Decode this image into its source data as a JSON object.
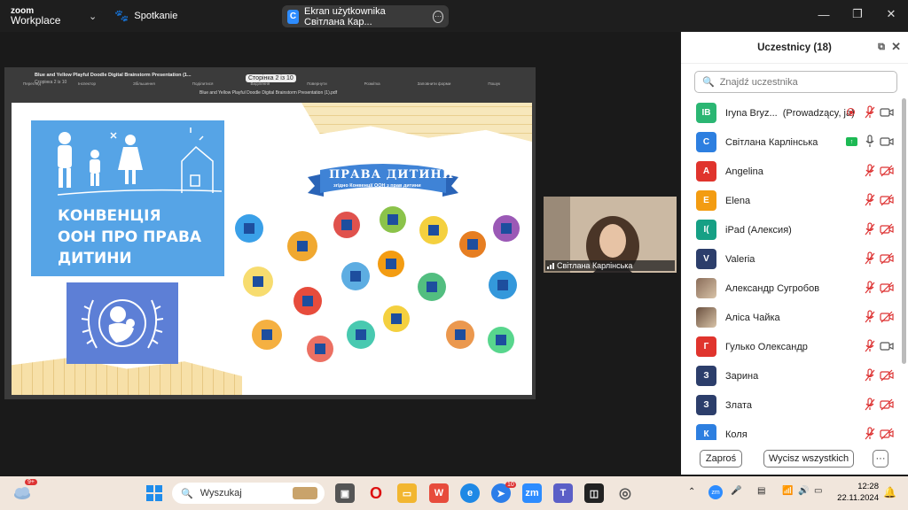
{
  "app": {
    "logo_line1": "zoom",
    "logo_line2": "Workplace",
    "meeting_label": "Spotkanie",
    "share_label": "Ekran użytkownika Світлана Кар..."
  },
  "viewer": {
    "doc_title": "Blue and Yellow Playful Doodle Digital Brainstorm Presentation (1...",
    "page_info": "Сторінка 2 із 10",
    "page_pill": "Сторінка 2 із 10",
    "subtitle": "Blue and Yellow Playful Doodle Digital Brainstorm Presentation (1).pdf",
    "tools": [
      "Перегляд",
      "Інспектор",
      "Збільшення",
      "Поділитися",
      "Виділення",
      "Повернути",
      "Розмітка",
      "Заповнити форми",
      "Пошук"
    ]
  },
  "slide": {
    "convention_text": [
      "КОНВЕНЦІЯ",
      "ООН ПРО ПРАВА",
      "ДИТИНИ"
    ],
    "banner_title": "ПРАВА ДИТИНИ",
    "banner_sub": "згідно Конвенції ООН з прав дитини"
  },
  "video": {
    "name": "Світлана Карлінська"
  },
  "panel": {
    "title": "Uczestnicy (18)",
    "search_placeholder": "Znajdź uczestnika",
    "participants": [
      {
        "initials": "IB",
        "name": "Iryna Bryz...",
        "role": "(Prowadzący, ja)",
        "color": "#2bb673"
      },
      {
        "initials": "С",
        "name": "Світлана Карлінська",
        "role": "",
        "color": "#2d7fe0"
      },
      {
        "initials": "A",
        "name": "Angelina",
        "role": "",
        "color": "#e0342d"
      },
      {
        "initials": "E",
        "name": "Elena",
        "role": "",
        "color": "#f39c12"
      },
      {
        "initials": "I(",
        "name": "iPad (Алексия)",
        "role": "",
        "color": "#16a085"
      },
      {
        "initials": "V",
        "name": "Valeria",
        "role": "",
        "color": "#2c3e6b"
      },
      {
        "initials": "",
        "name": "Александр Сугробов",
        "role": "",
        "color": "#8a6d5a"
      },
      {
        "initials": "",
        "name": "Аліса Чайка",
        "role": "",
        "color": "#6b5140"
      },
      {
        "initials": "Г",
        "name": "Гулько Олександр",
        "role": "",
        "color": "#e0342d"
      },
      {
        "initials": "З",
        "name": "Зарина",
        "role": "",
        "color": "#2c3e6b"
      },
      {
        "initials": "З",
        "name": "Злата",
        "role": "",
        "color": "#2c3e6b"
      },
      {
        "initials": "К",
        "name": "Коля",
        "role": "",
        "color": "#2d7fe0"
      }
    ],
    "invite_label": "Zaproś",
    "mute_all_label": "Wycisz wszystkich",
    "more_label": "···"
  },
  "taskbar": {
    "search_label": "Wyszukaj",
    "weather_badge": "9+",
    "time": "12:28",
    "date": "22.11.2024",
    "notif_count": "10"
  }
}
